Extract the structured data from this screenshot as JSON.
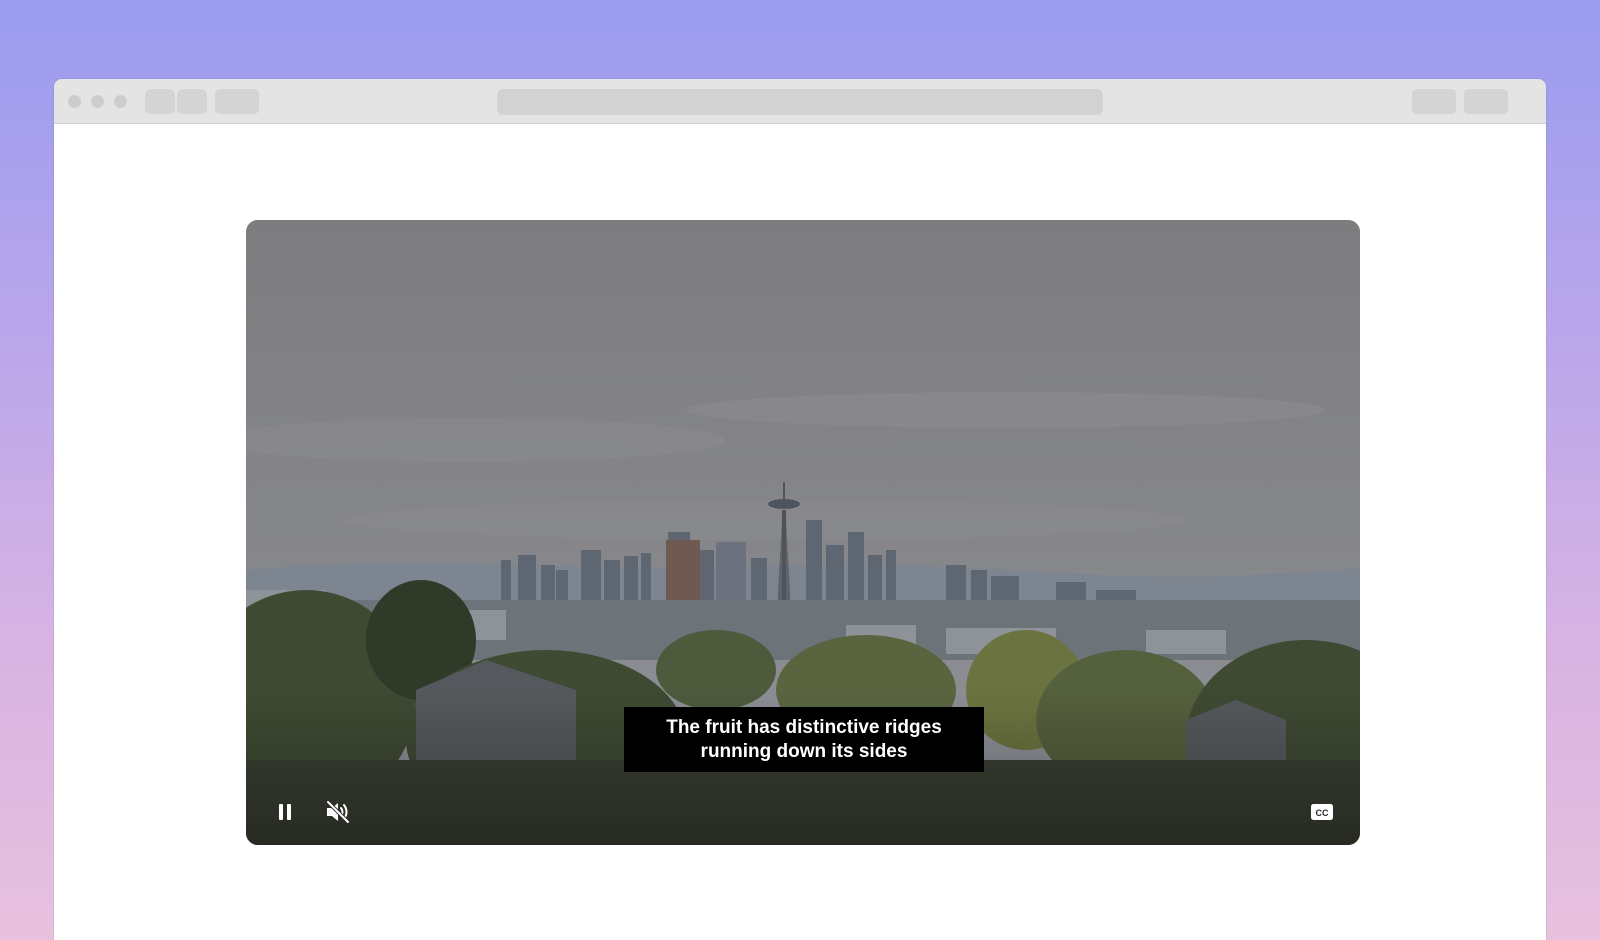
{
  "player": {
    "caption_lines": [
      "The fruit has distinctive ridges",
      "running down its sides"
    ],
    "cc_label": "CC",
    "state": "playing",
    "muted": true
  },
  "icons": {
    "pause": "pause-icon",
    "mute": "volume-muted-icon",
    "cc": "closed-captions-icon"
  }
}
